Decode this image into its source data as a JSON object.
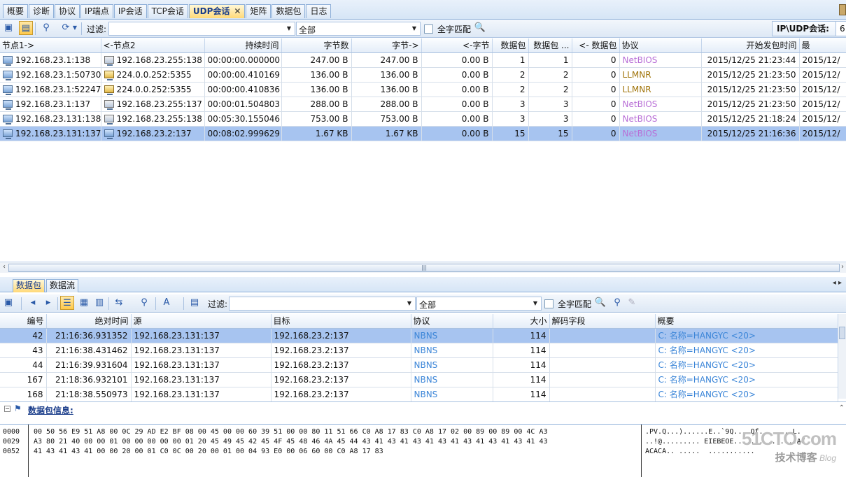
{
  "tabs": [
    {
      "label": "概要"
    },
    {
      "label": "诊断"
    },
    {
      "label": "协议"
    },
    {
      "label": "IP端点"
    },
    {
      "label": "IP会话"
    },
    {
      "label": "TCP会话"
    },
    {
      "label": "UDP会话",
      "active": true
    },
    {
      "label": "矩阵"
    },
    {
      "label": "数据包"
    },
    {
      "label": "日志"
    }
  ],
  "close_glyph": "✕",
  "toolbar1": {
    "filter_label": "过滤:",
    "filter_value": "",
    "scope_value": "全部",
    "match_label": "全字匹配",
    "count_label": "IP\\UDP会话:",
    "count_value": "6"
  },
  "sessions": {
    "columns": [
      "节点1->",
      "<-节点2",
      "持续时间",
      "字节数",
      "字节->",
      "<-字节",
      "数据包",
      "数据包 ...",
      "<- 数据包",
      "协议",
      "开始发包时间",
      "最"
    ],
    "rows": [
      {
        "n1": "192.168.23.1:138",
        "n2": "192.168.23.255:138",
        "n2icon": "bcast",
        "dur": "00:00:00.000000",
        "bytes": "247.00 B",
        "out": "247.00 B",
        "in": "0.00 B",
        "pk": "1",
        "pkout": "1",
        "pkin": "0",
        "proto": "NetBIOS",
        "pclass": "proto-netbios",
        "start": "2015/12/25 21:23:44",
        "last": "2015/12/"
      },
      {
        "n1": "192.168.23.1:50730",
        "n2": "224.0.0.252:5355",
        "n2icon": "group",
        "dur": "00:00:00.410169",
        "bytes": "136.00 B",
        "out": "136.00 B",
        "in": "0.00 B",
        "pk": "2",
        "pkout": "2",
        "pkin": "0",
        "proto": "LLMNR",
        "pclass": "proto-llmnr",
        "start": "2015/12/25 21:23:50",
        "last": "2015/12/"
      },
      {
        "n1": "192.168.23.1:52247",
        "n2": "224.0.0.252:5355",
        "n2icon": "group",
        "dur": "00:00:00.410836",
        "bytes": "136.00 B",
        "out": "136.00 B",
        "in": "0.00 B",
        "pk": "2",
        "pkout": "2",
        "pkin": "0",
        "proto": "LLMNR",
        "pclass": "proto-llmnr",
        "start": "2015/12/25 21:23:50",
        "last": "2015/12/"
      },
      {
        "n1": "192.168.23.1:137",
        "n2": "192.168.23.255:137",
        "n2icon": "bcast",
        "dur": "00:00:01.504803",
        "bytes": "288.00 B",
        "out": "288.00 B",
        "in": "0.00 B",
        "pk": "3",
        "pkout": "3",
        "pkin": "0",
        "proto": "NetBIOS",
        "pclass": "proto-netbios",
        "start": "2015/12/25 21:23:50",
        "last": "2015/12/"
      },
      {
        "n1": "192.168.23.131:138",
        "n2": "192.168.23.255:138",
        "n2icon": "bcast",
        "dur": "00:05:30.155046",
        "bytes": "753.00 B",
        "out": "753.00 B",
        "in": "0.00 B",
        "pk": "3",
        "pkout": "3",
        "pkin": "0",
        "proto": "NetBIOS",
        "pclass": "proto-netbios",
        "start": "2015/12/25 21:18:24",
        "last": "2015/12/"
      },
      {
        "n1": "192.168.23.131:137",
        "n2": "192.168.23.2:137",
        "n2icon": "host",
        "dur": "00:08:02.999629",
        "bytes": "1.67 KB",
        "out": "1.67 KB",
        "in": "0.00 B",
        "pk": "15",
        "pkout": "15",
        "pkin": "0",
        "proto": "NetBIOS",
        "pclass": "proto-netbios",
        "start": "2015/12/25 21:16:36",
        "last": "2015/12/",
        "selected": true
      }
    ]
  },
  "subtabs": [
    {
      "label": "数据包",
      "active": true
    },
    {
      "label": "数据流"
    }
  ],
  "toolbar2": {
    "filter_label": "过滤:",
    "filter_value": "",
    "scope_value": "全部",
    "match_label": "全字匹配"
  },
  "packets": {
    "columns": [
      "编号",
      "绝对时间",
      "源",
      "目标",
      "协议",
      "大小",
      "解码字段",
      "概要"
    ],
    "rows": [
      {
        "no": "42",
        "time": "21:16:36.931352",
        "src": "192.168.23.131:137",
        "dst": "192.168.23.2:137",
        "proto": "NBNS",
        "size": "114",
        "decode": "",
        "summary": "C: 名称=HANGYC <20>",
        "selected": true
      },
      {
        "no": "43",
        "time": "21:16:38.431462",
        "src": "192.168.23.131:137",
        "dst": "192.168.23.2:137",
        "proto": "NBNS",
        "size": "114",
        "decode": "",
        "summary": "C: 名称=HANGYC <20>"
      },
      {
        "no": "44",
        "time": "21:16:39.931604",
        "src": "192.168.23.131:137",
        "dst": "192.168.23.2:137",
        "proto": "NBNS",
        "size": "114",
        "decode": "",
        "summary": "C: 名称=HANGYC <20>"
      },
      {
        "no": "167",
        "time": "21:18:36.932101",
        "src": "192.168.23.131:137",
        "dst": "192.168.23.2:137",
        "proto": "NBNS",
        "size": "114",
        "decode": "",
        "summary": "C: 名称=HANGYC <20>"
      },
      {
        "no": "168",
        "time": "21:18:38.550973",
        "src": "192.168.23.131:137",
        "dst": "192.168.23.2:137",
        "proto": "NBNS",
        "size": "114",
        "decode": "",
        "summary": "C: 名称=HANGYC <20>"
      }
    ]
  },
  "detail": {
    "title": "数据包信息:"
  },
  "hex": {
    "offsets": "0000\n0029\n0052",
    "bytes": "00 50 56 E9 51 A8 00 0C 29 AD E2 BF 08 00 45 00 00 60 39 51 00 00 80 11 51 66 C0 A8 17 83 C0 A8 17 02 00 89 00 89 00 4C A3\nA3 80 21 40 00 00 01 00 00 00 00 00 01 20 45 49 45 42 45 4F 45 48 46 4A 45 44 43 41 43 41 43 41 43 41 43 41 43 41 43 41 43\n41 43 41 43 41 00 00 20 00 01 C0 0C 00 20 00 01 00 04 93 E0 00 06 60 00 C0 A8 17 83",
    "ascii": ".PV.Q...)......E..`9Q....Qf........L.\n..!@......... EIEBEOE...............AC\nACACA.. .....  ..........."
  },
  "watermark": {
    "big": "51CTO.com",
    "small": "技术博客",
    "tag": "Blog"
  }
}
